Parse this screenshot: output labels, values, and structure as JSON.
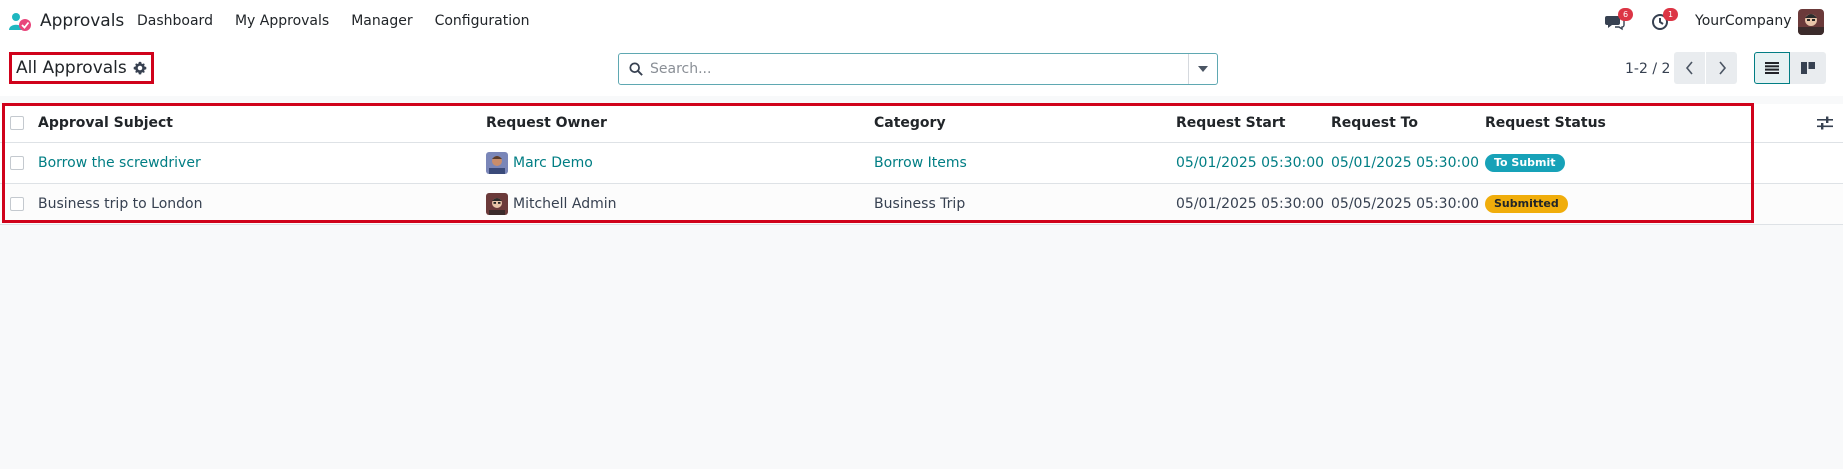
{
  "navbar": {
    "app_title": "Approvals",
    "menu": [
      {
        "label": "Dashboard"
      },
      {
        "label": "My Approvals"
      },
      {
        "label": "Manager"
      },
      {
        "label": "Configuration"
      }
    ],
    "messages_count": "6",
    "activities_count": "1",
    "company": "YourCompany"
  },
  "control_panel": {
    "title": "All Approvals",
    "search_placeholder": "Search...",
    "pager": "1-2 / 2"
  },
  "table": {
    "columns": [
      "Approval Subject",
      "Request Owner",
      "Category",
      "Request Start",
      "Request To",
      "Request Status"
    ],
    "rows": [
      {
        "subject": "Borrow the screwdriver",
        "owner": "Marc Demo",
        "category": "Borrow Items",
        "start": "05/01/2025 05:30:00",
        "to": "05/01/2025 05:30:00",
        "status": "To Submit",
        "status_color": "#17a2b8",
        "status_text_color": "#ffffff",
        "linked": true
      },
      {
        "subject": "Business trip to London",
        "owner": "Mitchell Admin",
        "category": "Business Trip",
        "start": "05/01/2025 05:30:00",
        "to": "05/05/2025 05:30:00",
        "status": "Submitted",
        "status_color": "#f0ad0b",
        "status_text_color": "#212529",
        "linked": false
      }
    ]
  },
  "colors": {
    "accent": "#017e84",
    "highlight": "#d0021b",
    "badge": "#dc3545"
  }
}
